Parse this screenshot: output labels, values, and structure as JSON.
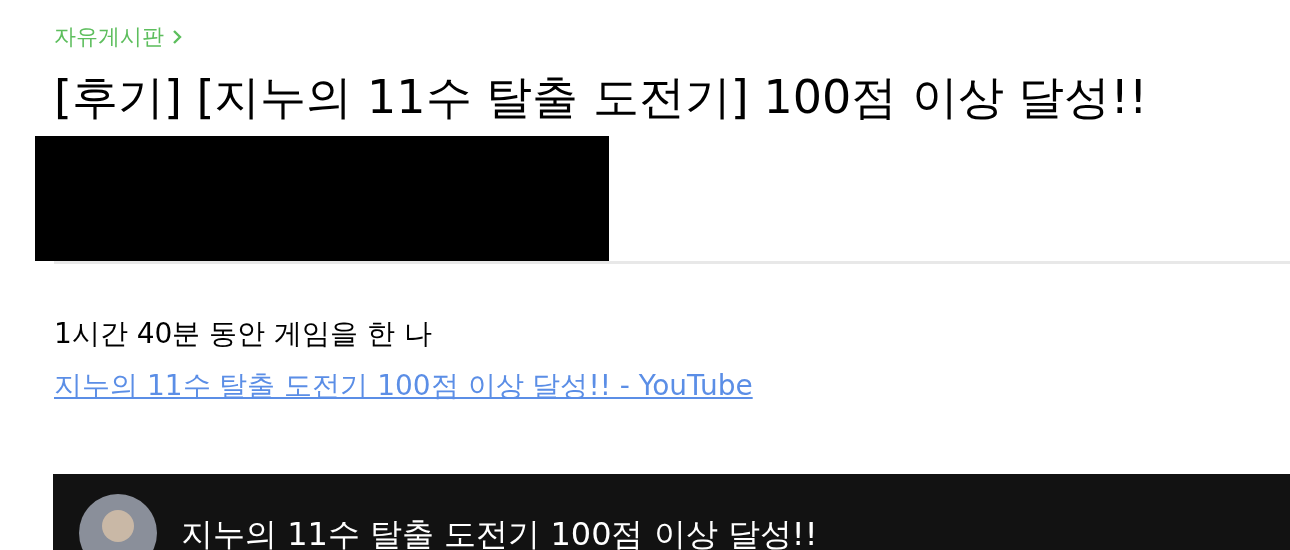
{
  "breadcrumb": {
    "label": "자유게시판"
  },
  "post": {
    "title": "[후기] [지누의 11수 탈출 도전기] 100점 이상 달성!!",
    "body": "1시간 40분 동안 게임을 한 나",
    "link": "지누의 11수 탈출 도전기 100점 이상 달성!! - YouTube"
  },
  "video": {
    "title": "지누의 11수 탈출 도전기 100점 이상 달성!!"
  }
}
